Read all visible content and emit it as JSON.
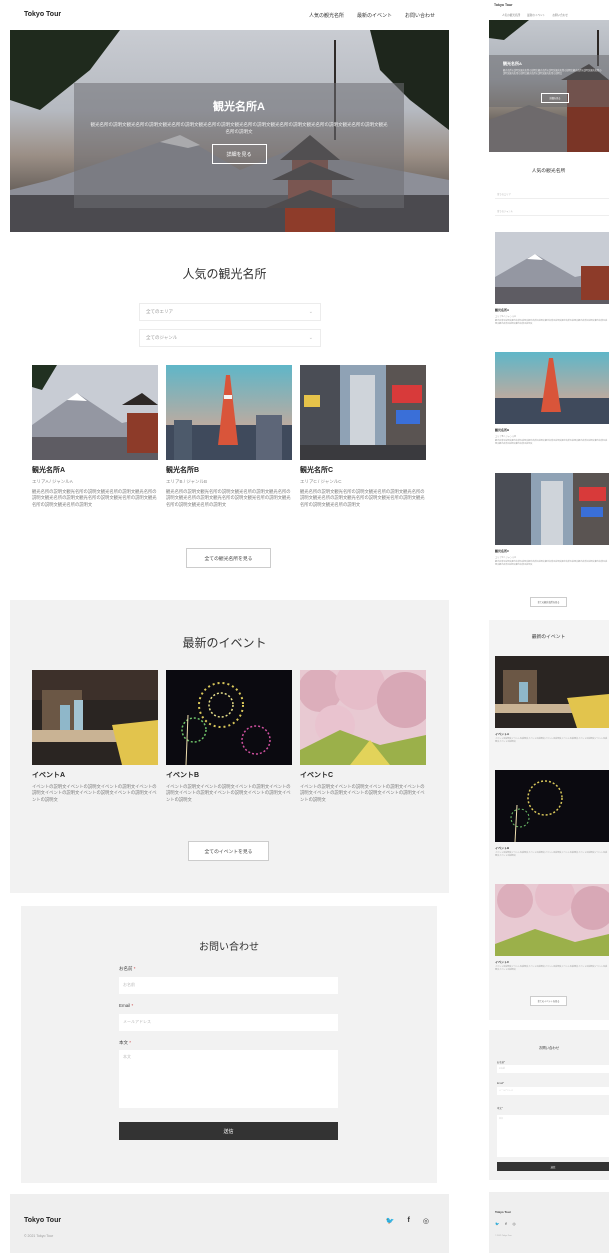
{
  "site": {
    "logo": "Tokyo Tour"
  },
  "nav": {
    "spots": "人気の観光名所",
    "events": "最新のイベント",
    "contact": "お問い合わせ"
  },
  "hero": {
    "title": "観光名所A",
    "description": "観光名所の説明文観光名所の説明文観光名所の説明文観光名所の説明文観光名所の説明文観光名所の説明文観光名所の説明文観光名所の説明文観光名所の説明文",
    "button": "詳細を見る"
  },
  "spots": {
    "title": "人気の観光名所",
    "filters": {
      "area": "全てのエリア",
      "genre": "全てのジャンル"
    },
    "cards": [
      {
        "title": "観光名所A",
        "meta": "エリアA / ジャンルA",
        "desc": "観光名所の説明文観光名所の説明文観光名所の説明文観光名所の説明文観光名所の説明文観光名所の説明文観光名所の説明文観光名所の説明文観光名所の説明文"
      },
      {
        "title": "観光名所B",
        "meta": "エリアB / ジャンルB",
        "desc": "観光名所の説明文観光名所の説明文観光名所の説明文観光名所の説明文観光名所の説明文観光名所の説明文観光名所の説明文観光名所の説明文観光名所の説明文"
      },
      {
        "title": "観光名所C",
        "meta": "エリアC / ジャンルC",
        "desc": "観光名所の説明文観光名所の説明文観光名所の説明文観光名所の説明文観光名所の説明文観光名所の説明文観光名所の説明文観光名所の説明文観光名所の説明文"
      }
    ],
    "more": "全ての観光名所を見る"
  },
  "events": {
    "title": "最新のイベント",
    "cards": [
      {
        "title": "イベントA",
        "desc": "イベントの説明文イベントの説明文イベントの説明文イベントの説明文イベントの説明文イベントの説明文イベントの説明文イベントの説明文"
      },
      {
        "title": "イベントB",
        "desc": "イベントの説明文イベントの説明文イベントの説明文イベントの説明文イベントの説明文イベントの説明文イベントの説明文イベントの説明文"
      },
      {
        "title": "イベントC",
        "desc": "イベントの説明文イベントの説明文イベントの説明文イベントの説明文イベントの説明文イベントの説明文イベントの説明文イベントの説明文"
      }
    ],
    "more": "全てのイベントを見る"
  },
  "contact": {
    "title": "お問い合わせ",
    "required_mark": "*",
    "name_label": "お名前",
    "name_placeholder": "お名前",
    "email_label": "Email",
    "email_placeholder": "メールアドレス",
    "body_label": "本文",
    "body_placeholder": "本文",
    "submit": "送信"
  },
  "footer": {
    "logo": "Tokyo Tour",
    "copyright": "© 2021 Tokyo Tour"
  },
  "colors": {
    "accent_dark": "#333333",
    "section_bg": "#f2f2f2",
    "text_muted": "#777777"
  },
  "icons": {
    "social": [
      "twitter-icon",
      "facebook-icon",
      "instagram-icon"
    ]
  }
}
